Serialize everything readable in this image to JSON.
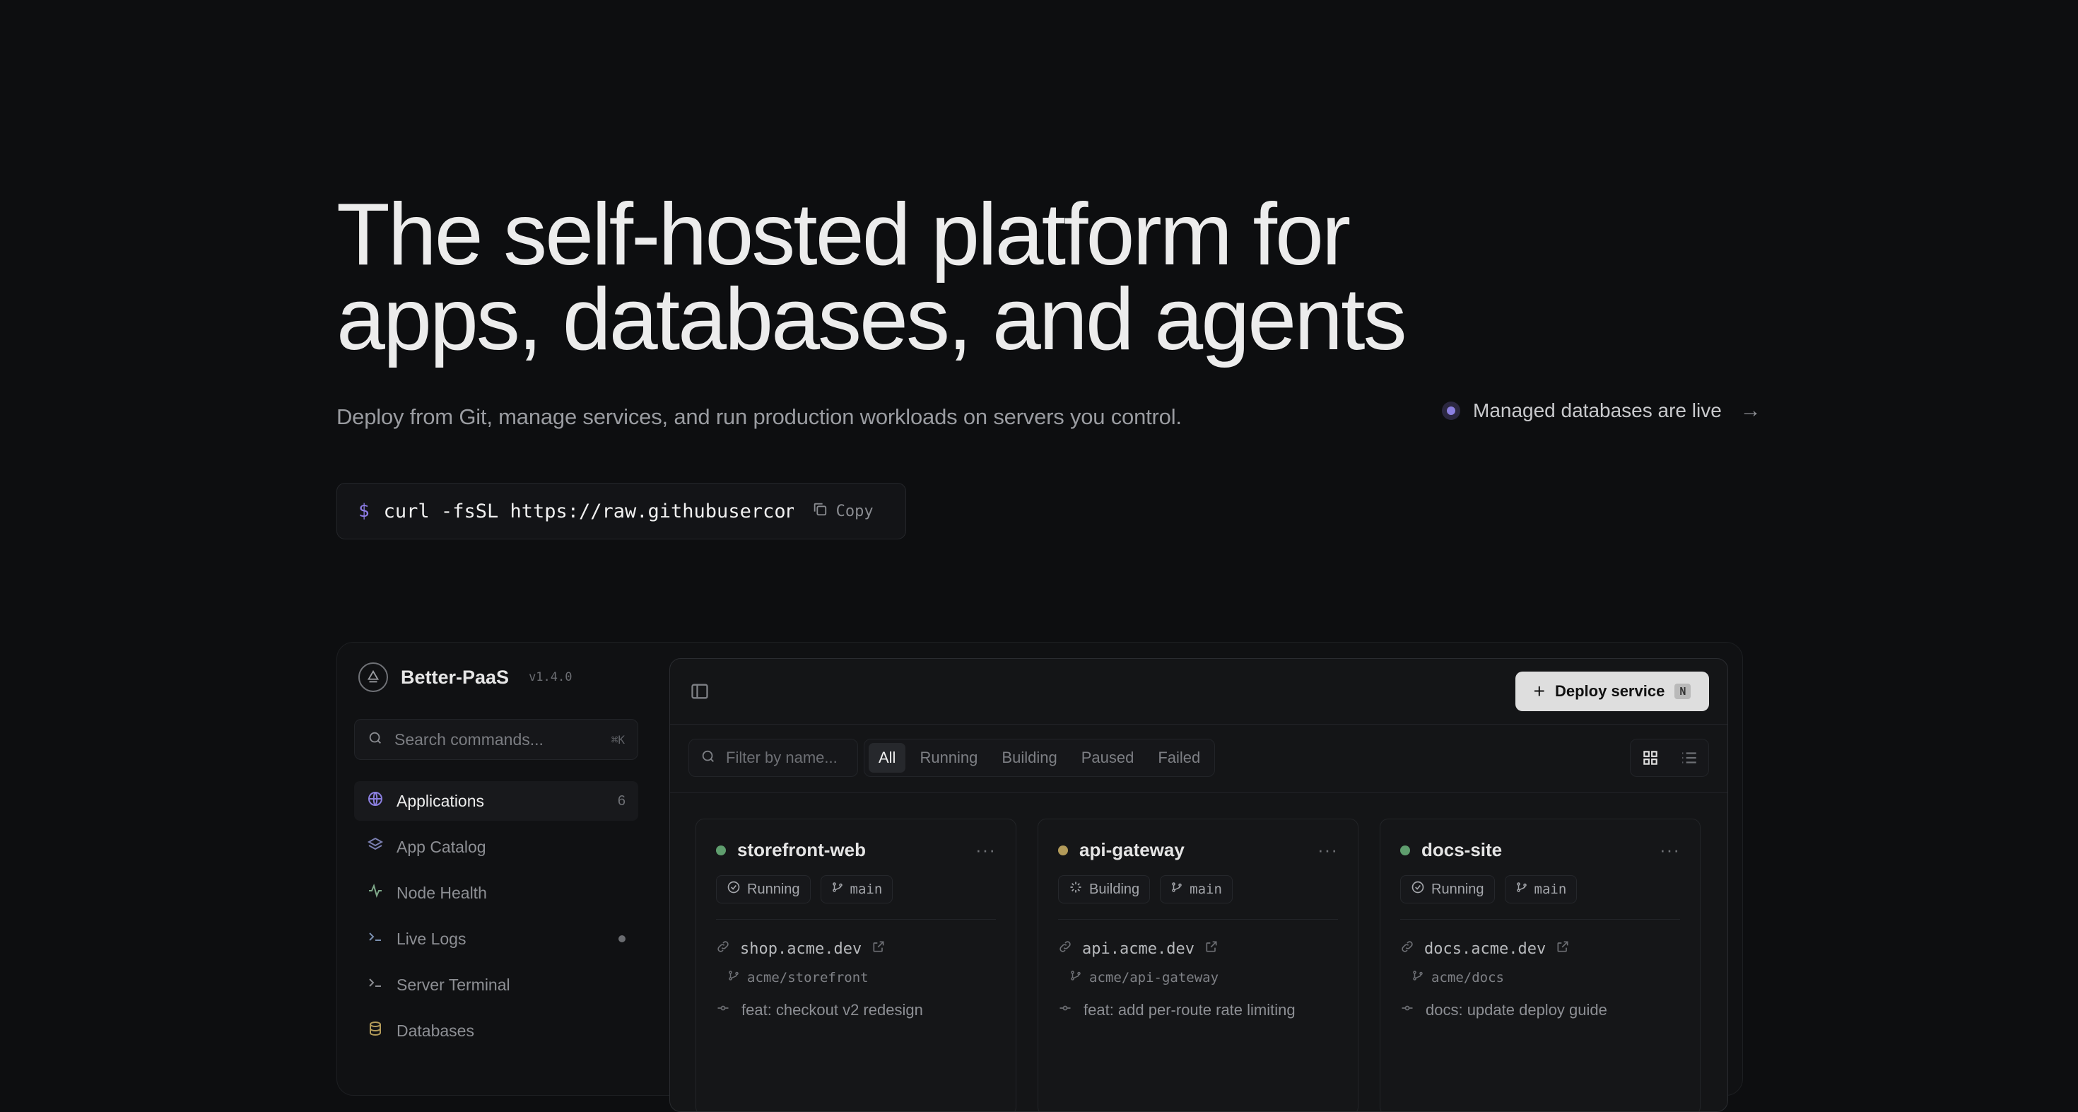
{
  "hero": {
    "headline_line1": "The self-hosted platform for",
    "headline_line2": "apps, databases, and agents",
    "subtitle": "Deploy from Git, manage services, and run production workloads on servers you control.",
    "announcement": "Managed databases are live"
  },
  "install": {
    "prompt": "$",
    "command": "curl -fsSL https://raw.githubuserconten",
    "copy_label": "Copy"
  },
  "app": {
    "brand": {
      "name": "Better-PaaS",
      "version": "v1.4.0"
    },
    "search": {
      "placeholder": "Search commands...",
      "shortcut": "⌘K"
    },
    "nav": [
      {
        "label": "Applications",
        "count": "6",
        "icon": "globe-icon",
        "active": true
      },
      {
        "label": "App Catalog",
        "icon": "layers-icon"
      },
      {
        "label": "Node Health",
        "icon": "activity-icon"
      },
      {
        "label": "Live Logs",
        "icon": "terminal-icon"
      },
      {
        "label": "Server Terminal",
        "icon": "terminal-icon"
      },
      {
        "label": "Databases",
        "icon": "database-icon"
      }
    ],
    "toolbar": {
      "deploy_label": "Deploy service",
      "deploy_key": "N"
    },
    "filter": {
      "placeholder": "Filter by name..."
    },
    "tabs": [
      "All",
      "Running",
      "Building",
      "Paused",
      "Failed"
    ],
    "services": [
      {
        "name": "storefront-web",
        "status": "Running",
        "status_color": "#5f9e6e",
        "branch": "main",
        "url": "shop.acme.dev",
        "repo": "acme/storefront",
        "commit": "feat: checkout v2 redesign"
      },
      {
        "name": "api-gateway",
        "status": "Building",
        "status_color": "#b39b5a",
        "branch": "main",
        "url": "api.acme.dev",
        "repo": "acme/api-gateway",
        "commit": "feat: add per-route rate limiting"
      },
      {
        "name": "docs-site",
        "status": "Running",
        "status_color": "#5f9e6e",
        "branch": "main",
        "url": "docs.acme.dev",
        "repo": "acme/docs",
        "commit": "docs: update deploy guide"
      }
    ]
  },
  "colors": {
    "accent": "#8b7fe0",
    "background": "#0d0e10"
  }
}
